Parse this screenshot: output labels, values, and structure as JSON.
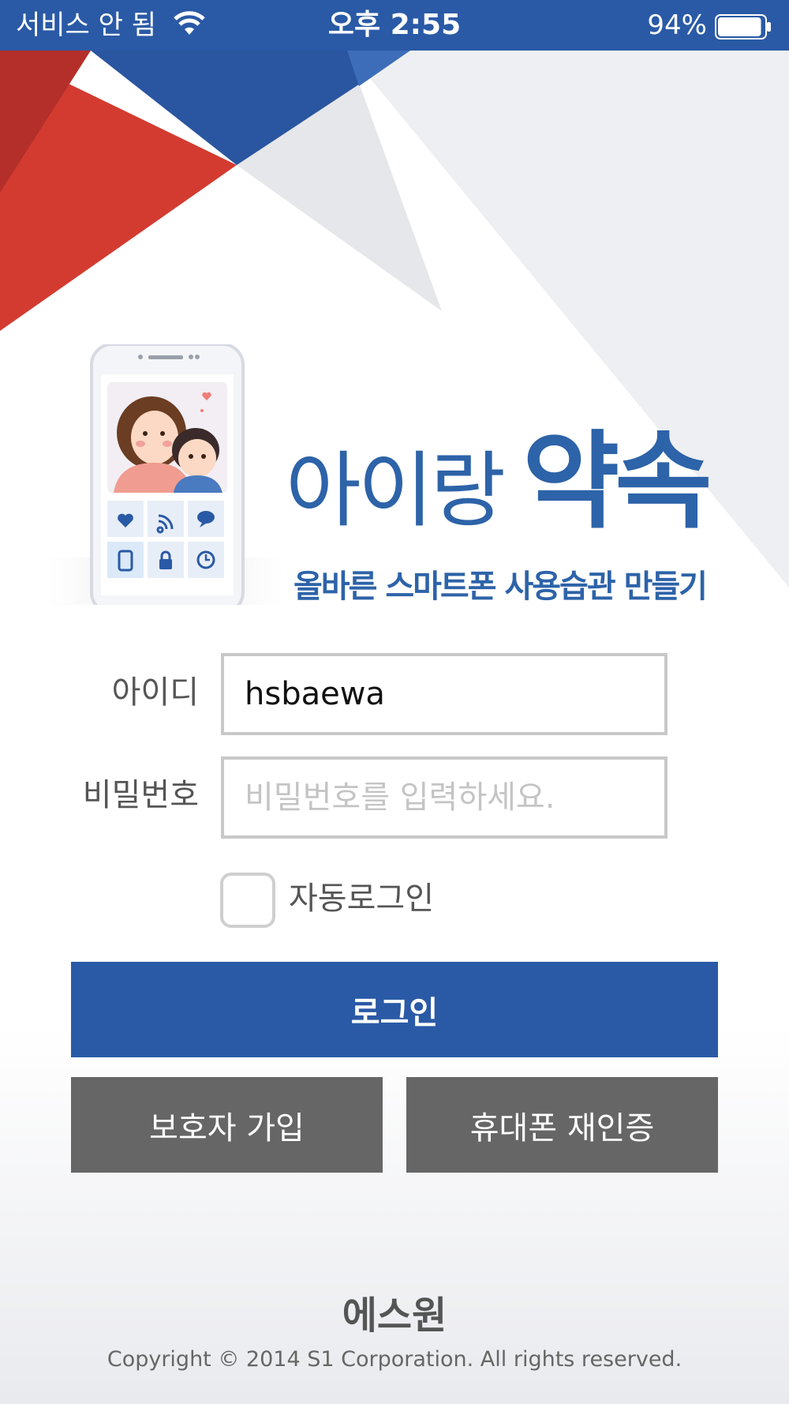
{
  "status_bar": {
    "carrier": "서비스 안 됨",
    "time": "오후 2:55",
    "battery_percent": "94%",
    "battery_level": 0.94
  },
  "hero": {
    "title_light": "아이랑",
    "title_bold": "약속",
    "subtitle": "올바른 스마트폰 사용습관 만들기"
  },
  "form": {
    "id_label": "아이디",
    "id_value": "hsbaewa",
    "password_label": "비밀번호",
    "password_placeholder": "비밀번호를 입력하세요.",
    "auto_login_label": "자동로그인",
    "auto_login_checked": false
  },
  "buttons": {
    "login": "로그인",
    "guardian_signup": "보호자 가입",
    "phone_reauth": "휴대폰 재인증"
  },
  "footer": {
    "logo": "에스원",
    "copyright": "Copyright © 2014 S1 Corporation. All rights reserved."
  },
  "colors": {
    "brand_blue": "#2a5aa6",
    "accent_red": "#d33b30",
    "button_gray": "#666666"
  }
}
